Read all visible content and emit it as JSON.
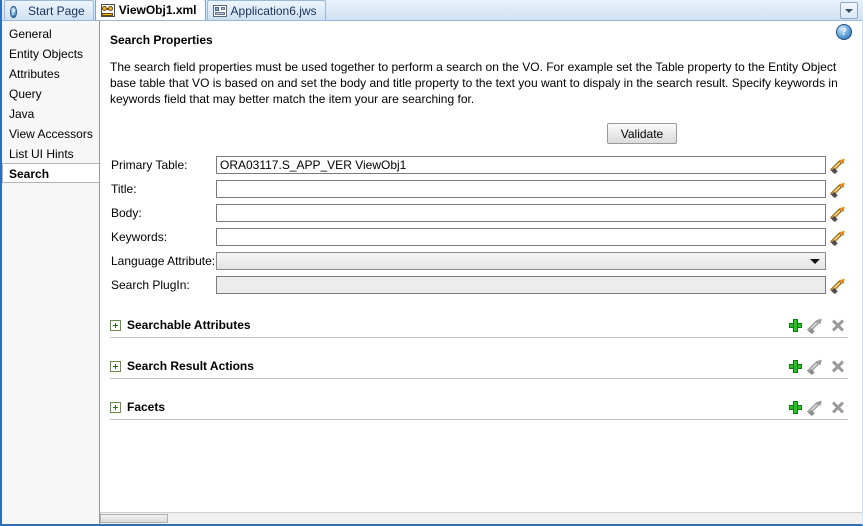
{
  "window": {
    "accent_color": "#2f6fb5"
  },
  "tabbar": {
    "tabs": [
      {
        "label": "Start Page",
        "icon": "help-circle-icon",
        "selected": false
      },
      {
        "label": "ViewObj1.xml",
        "icon": "view-object-icon",
        "selected": true
      },
      {
        "label": "Application6.jws",
        "icon": "application-icon",
        "selected": false
      }
    ],
    "menu_button_icon": "chevron-down-icon"
  },
  "sidebar": {
    "items": [
      {
        "label": "General",
        "selected": false
      },
      {
        "label": "Entity Objects",
        "selected": false
      },
      {
        "label": "Attributes",
        "selected": false
      },
      {
        "label": "Query",
        "selected": false
      },
      {
        "label": "Java",
        "selected": false
      },
      {
        "label": "View Accessors",
        "selected": false
      },
      {
        "label": "List UI Hints",
        "selected": false
      },
      {
        "label": "Search",
        "selected": true
      }
    ]
  },
  "panel": {
    "title": "Search Properties",
    "help_icon": "help-circle-icon",
    "help_glyph": "?",
    "description": "The search field properties must be used together to perform a search on the VO. For example set the Table property to the Entity Object base table that VO is based on and set the body and title property to the text you want to dispaly in the search result. Specify keywords in keywords field that may better match the item your are searching for.",
    "validate_label": "Validate"
  },
  "form": {
    "fields": [
      {
        "label": "Primary Table:",
        "value": "ORA03117.S_APP_VER ViewObj1",
        "placeholder": "",
        "type": "text",
        "disabled": false,
        "has_edit": true,
        "name": "primary-table"
      },
      {
        "label": "Title:",
        "value": "",
        "placeholder": "",
        "type": "text",
        "disabled": false,
        "has_edit": true,
        "name": "title"
      },
      {
        "label": "Body:",
        "value": "",
        "placeholder": "",
        "type": "text",
        "disabled": false,
        "has_edit": true,
        "name": "body"
      },
      {
        "label": "Keywords:",
        "value": "",
        "placeholder": "",
        "type": "text",
        "disabled": false,
        "has_edit": true,
        "name": "keywords"
      },
      {
        "label": "Language Attribute:",
        "value": "",
        "placeholder": "",
        "type": "select",
        "disabled": false,
        "has_edit": false,
        "name": "language-attribute"
      },
      {
        "label": "Search PlugIn:",
        "value": "",
        "placeholder": "",
        "type": "text",
        "disabled": true,
        "has_edit": true,
        "name": "search-plugin"
      }
    ]
  },
  "sections": [
    {
      "title": "Searchable Attributes",
      "expanded": false,
      "name": "searchable-attributes",
      "actions": [
        "add-icon",
        "edit-icon",
        "delete-icon"
      ]
    },
    {
      "title": "Search Result Actions",
      "expanded": false,
      "name": "search-result-actions",
      "actions": [
        "add-icon",
        "edit-icon",
        "delete-icon"
      ]
    },
    {
      "title": "Facets",
      "expanded": false,
      "name": "facets",
      "actions": [
        "add-icon",
        "edit-icon",
        "delete-icon"
      ]
    }
  ],
  "colors": {
    "add_icon": "#2fbe27",
    "disabled_icon": "#9a9a9a",
    "pencil_icon": "#f0b83a",
    "selection_border": "#2f6fb5"
  }
}
